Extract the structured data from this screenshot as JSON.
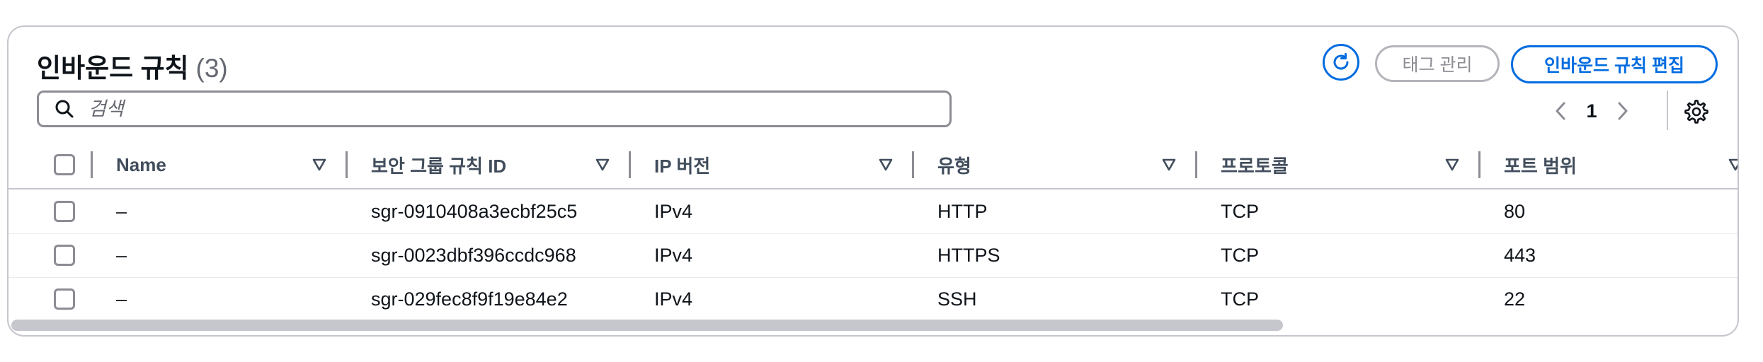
{
  "header": {
    "title": "인바운드 규칙",
    "count": "(3)",
    "refresh_icon": "refresh-icon",
    "manage_tags_label": "태그 관리",
    "edit_rules_label": "인바운드 규칙 편집"
  },
  "search": {
    "placeholder": "검색",
    "value": ""
  },
  "pagination": {
    "current_page": "1",
    "prev_icon": "chevron-left-icon",
    "next_icon": "chevron-right-icon",
    "settings_icon": "gear-icon"
  },
  "table": {
    "columns": [
      "Name",
      "보안 그룹 규칙 ID",
      "IP 버전",
      "유형",
      "프로토콜",
      "포트 범위"
    ],
    "rows": [
      {
        "name": "–",
        "rule_id": "sgr-0910408a3ecbf25c5",
        "ip_version": "IPv4",
        "type": "HTTP",
        "protocol": "TCP",
        "port_range": "80"
      },
      {
        "name": "–",
        "rule_id": "sgr-0023dbf396ccdc968",
        "ip_version": "IPv4",
        "type": "HTTPS",
        "protocol": "TCP",
        "port_range": "443"
      },
      {
        "name": "–",
        "rule_id": "sgr-029fec8f9f19e84e2",
        "ip_version": "IPv4",
        "type": "SSH",
        "protocol": "TCP",
        "port_range": "22"
      }
    ]
  },
  "colors": {
    "accent": "#006ce0",
    "border": "#c6c6cd",
    "text": "#0f141a",
    "muted": "#656871"
  }
}
